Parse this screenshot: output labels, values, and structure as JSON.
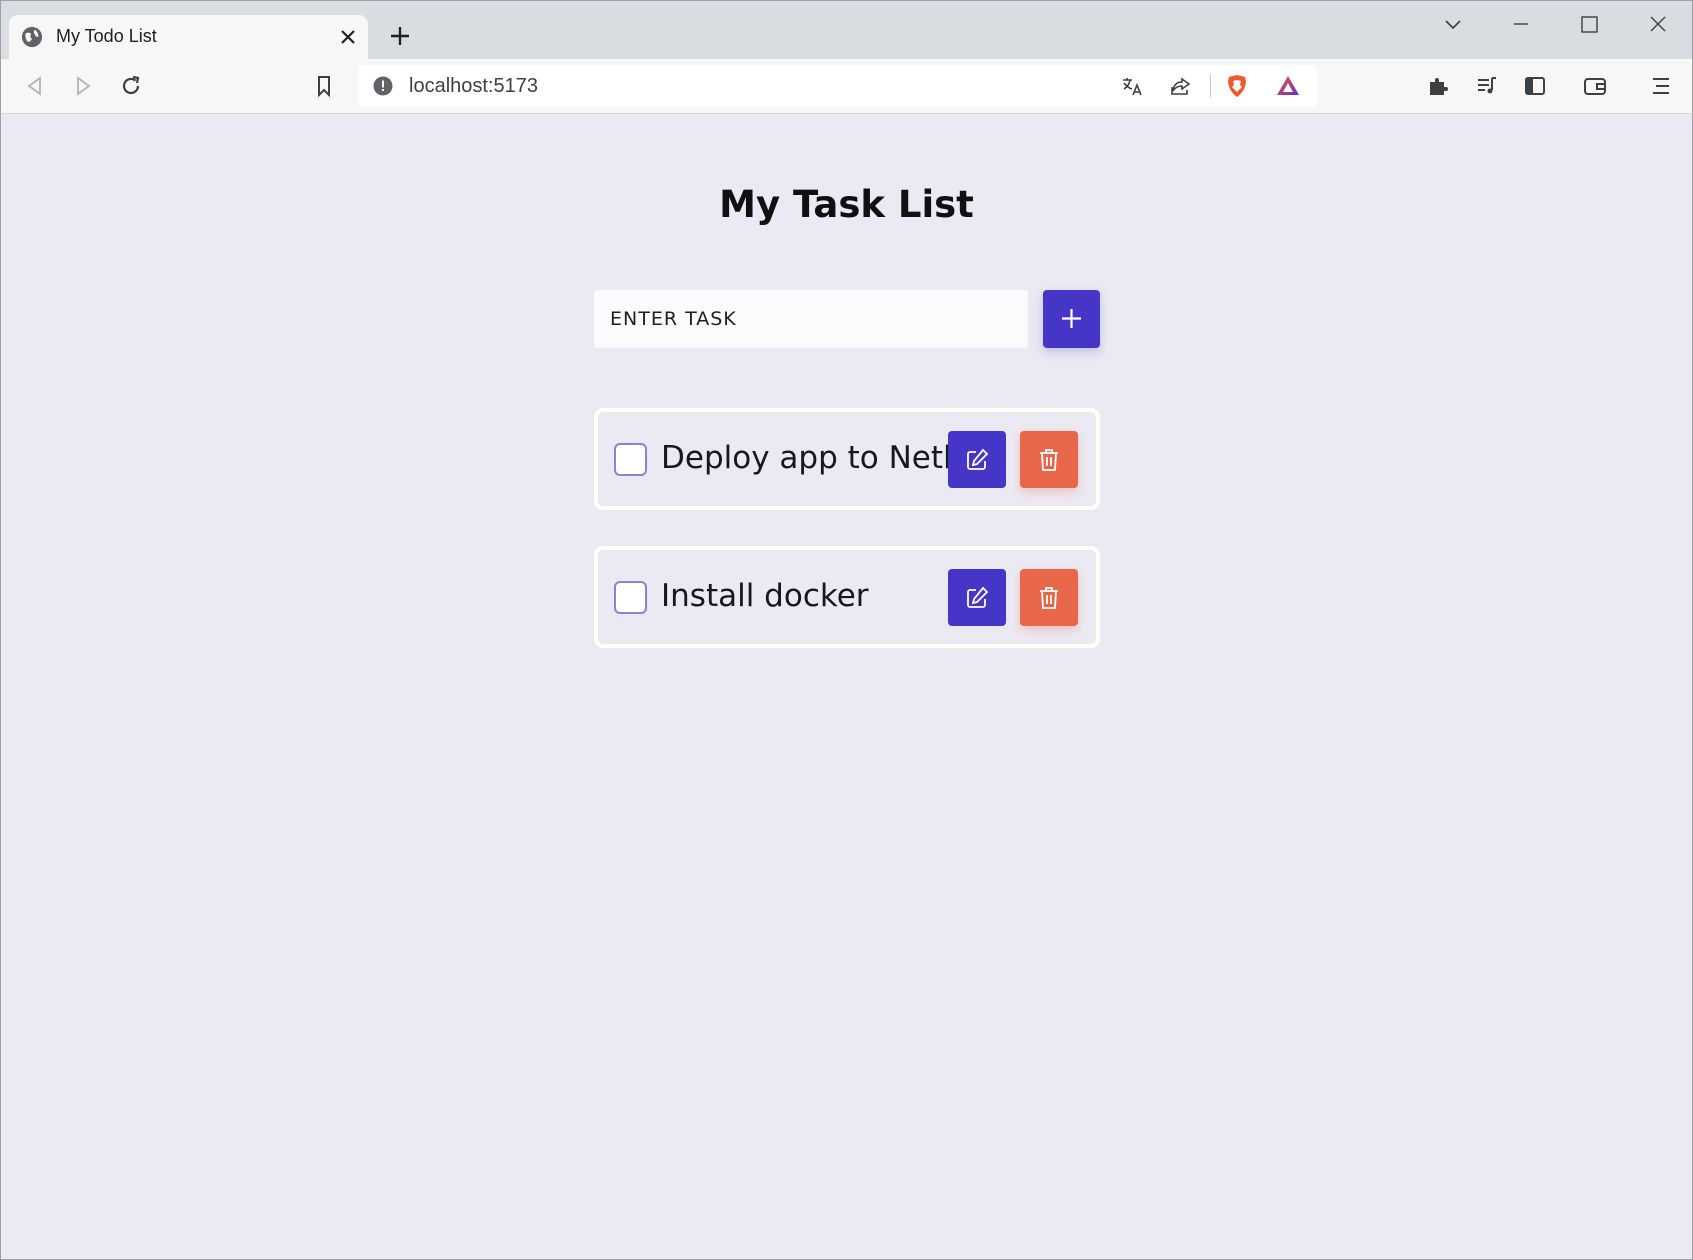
{
  "browser": {
    "tab_title": "My Todo List",
    "url": "localhost:5173",
    "icons": {
      "tab_favicon": "globe-icon",
      "tab_close": "close-icon",
      "new_tab": "plus-icon",
      "back": "back-arrow-icon",
      "forward": "forward-arrow-icon",
      "reload": "reload-icon",
      "bookmark": "bookmark-icon",
      "site_info": "info-icon",
      "translate": "translate-icon",
      "share": "share-icon",
      "brave_shield": "brave-shield-icon",
      "brave_rewards": "brave-rewards-icon",
      "extensions": "puzzle-icon",
      "media": "playlist-icon",
      "sidebar": "sidebar-icon",
      "wallet": "wallet-icon",
      "menu": "menu-icon"
    }
  },
  "app": {
    "title": "My Task List",
    "input_placeholder": "ENTER TASK",
    "input_value": "",
    "add_button_icon": "plus-icon",
    "tasks": [
      {
        "text": "Deploy app to Netlify",
        "checked": false
      },
      {
        "text": "Install docker",
        "checked": false
      }
    ],
    "colors": {
      "background": "#ebeaf3",
      "primary": "#4536c8",
      "danger": "#e8664a"
    }
  }
}
